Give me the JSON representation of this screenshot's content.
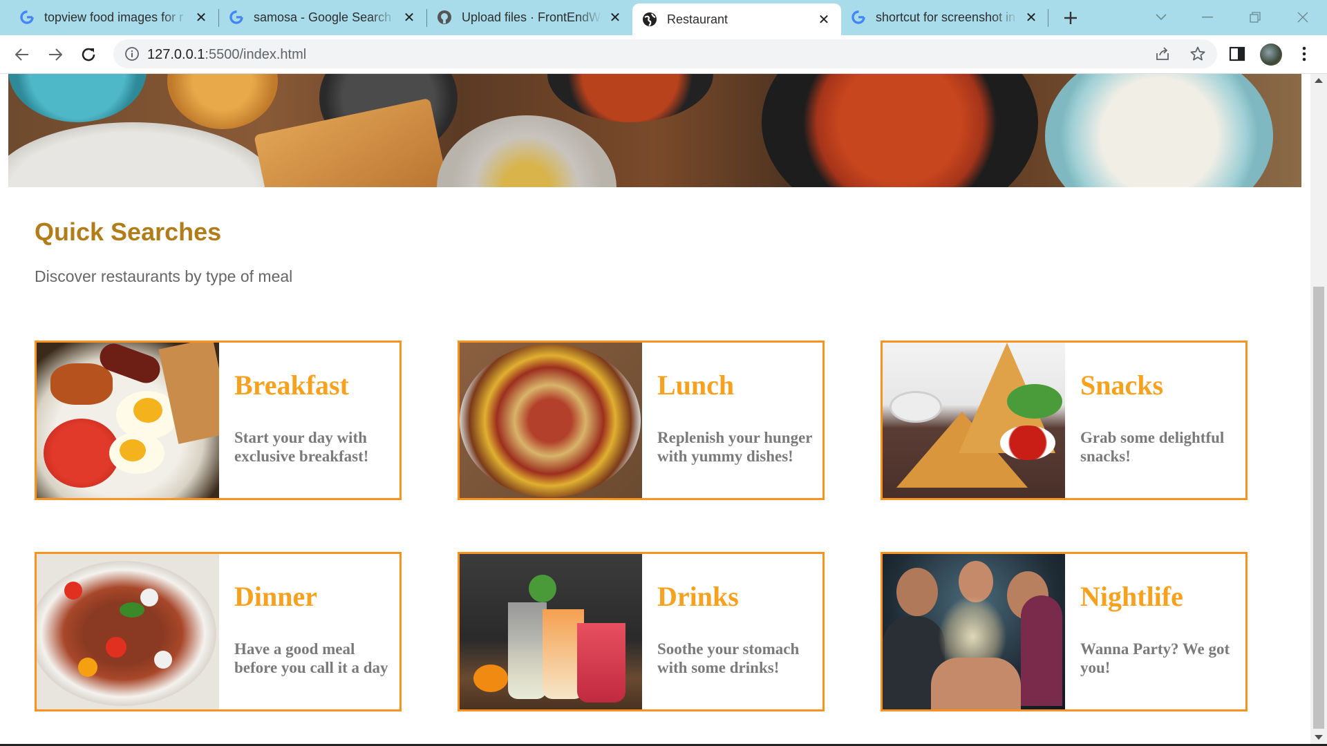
{
  "browser": {
    "tabs": [
      {
        "title": "topview food images for r",
        "favicon": "google-icon",
        "active": false
      },
      {
        "title": "samosa - Google Search",
        "favicon": "google-icon",
        "active": false
      },
      {
        "title": "Upload files · FrontEndWo",
        "favicon": "github-icon",
        "active": false
      },
      {
        "title": "Restaurant",
        "favicon": "globe-icon",
        "active": true
      },
      {
        "title": "shortcut for screenshot in",
        "favicon": "google-icon",
        "active": false
      }
    ],
    "url_host": "127.0.0.1",
    "url_rest": ":5500/index.html"
  },
  "page": {
    "section_title": "Quick Searches",
    "section_subtitle": "Discover restaurants by type of meal",
    "cards": [
      {
        "title": "Breakfast",
        "description": "Start your day with exclusive breakfast!"
      },
      {
        "title": "Lunch",
        "description": "Replenish your hunger with yummy dishes!"
      },
      {
        "title": "Snacks",
        "description": "Grab some delightful snacks!"
      },
      {
        "title": "Dinner",
        "description": "Have a good meal before you call it a day"
      },
      {
        "title": "Drinks",
        "description": "Soothe your stomach with some drinks!"
      },
      {
        "title": "Nightlife",
        "description": "Wanna Party? We got you!"
      }
    ]
  },
  "colors": {
    "tabstrip": "#a8dcea",
    "card_border": "#f7931e",
    "card_title": "#f7a11e",
    "section_title": "#b07d1a",
    "description": "#7a7a7a"
  }
}
